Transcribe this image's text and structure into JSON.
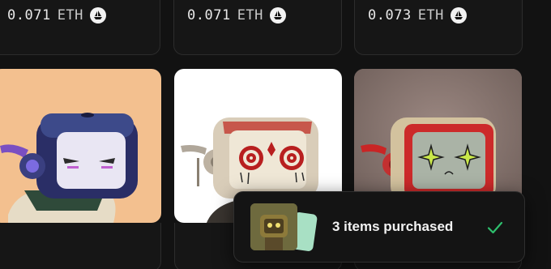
{
  "listings": [
    {
      "price": "0.071",
      "currency": "ETH",
      "currency_icon": "opensea-ship-icon"
    },
    {
      "price": "0.071",
      "currency": "ETH",
      "currency_icon": "opensea-ship-icon"
    },
    {
      "price": "0.073",
      "currency": "ETH",
      "currency_icon": "opensea-ship-icon"
    }
  ],
  "artworks": [
    {
      "background": "#f3c08f",
      "subject": "navy robot with purple eyes"
    },
    {
      "background": "#ffffff",
      "subject": "cream robot with red spiral eyes"
    },
    {
      "background": "#8f7a74",
      "subject": "red robot with green star eyes"
    }
  ],
  "toast": {
    "message": "3 items purchased",
    "status_icon": "checkmark-icon",
    "status_color": "#2ebf6d"
  }
}
